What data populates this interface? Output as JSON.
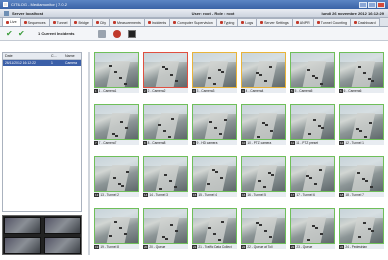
{
  "window": {
    "title": "CITILOG - Mediamonitor | 7.0.2"
  },
  "infobar": {
    "server": "Server localhost",
    "user": "User: root - Role : root",
    "datetime": "lundi 26 novembre 2012 16:12:29"
  },
  "tabs": [
    {
      "label": "Live",
      "active": true
    },
    {
      "label": "Sequences"
    },
    {
      "label": "Tunnel"
    },
    {
      "label": "Bridge"
    },
    {
      "label": "City"
    },
    {
      "label": "Measurements"
    },
    {
      "label": "Incidents"
    },
    {
      "label": "Computer Supervision"
    },
    {
      "label": "Typing"
    },
    {
      "label": "Logs"
    },
    {
      "label": "Server Settings"
    },
    {
      "label": "ANPR"
    },
    {
      "label": "Tunnel Counting"
    },
    {
      "label": "Dashboard"
    }
  ],
  "toolbar": {
    "incidents_label": "1 Current Incidents"
  },
  "incidents": {
    "columns": [
      "Date",
      "C...",
      "Name"
    ],
    "rows": [
      {
        "date": "26/11/2012 16:12:22",
        "c": "1",
        "name": "Camera"
      }
    ]
  },
  "cameras": [
    {
      "num": "1",
      "label": "1 - Camera1",
      "status": "normal"
    },
    {
      "num": "2",
      "label": "2 - Camera2",
      "status": "alarm"
    },
    {
      "num": "3",
      "label": "3 - Camera3",
      "status": "warn"
    },
    {
      "num": "4",
      "label": "4 - Camera4",
      "status": "warn"
    },
    {
      "num": "5",
      "label": "5 - Camera5",
      "status": "normal"
    },
    {
      "num": "6",
      "label": "6 - Camera6",
      "status": "normal"
    },
    {
      "num": "7",
      "label": "7 - Camera7",
      "status": "normal"
    },
    {
      "num": "8",
      "label": "8 - Camera8",
      "status": "normal"
    },
    {
      "num": "9",
      "label": "9 - HD camera",
      "status": "normal"
    },
    {
      "num": "10",
      "label": "10 - PTZ camera",
      "status": "normal"
    },
    {
      "num": "11",
      "label": "11 - PTZ preset",
      "status": "normal"
    },
    {
      "num": "12",
      "label": "12 - Tunnel 1",
      "status": "normal"
    },
    {
      "num": "13",
      "label": "13 - Tunnel 2",
      "status": "normal"
    },
    {
      "num": "14",
      "label": "14 - Tunnel 3",
      "status": "normal"
    },
    {
      "num": "15",
      "label": "15 - Tunnel 4",
      "status": "normal"
    },
    {
      "num": "16",
      "label": "16 - Tunnel 5",
      "status": "normal"
    },
    {
      "num": "17",
      "label": "17 - Tunnel 6",
      "status": "normal"
    },
    {
      "num": "18",
      "label": "18 - Tunnel 7",
      "status": "normal"
    },
    {
      "num": "19",
      "label": "19 - Tunnel 8",
      "status": "normal"
    },
    {
      "num": "20",
      "label": "20 - Queue",
      "status": "normal"
    },
    {
      "num": "21",
      "label": "21 - Traffic Data Collect",
      "status": "normal"
    },
    {
      "num": "22",
      "label": "22 - Queue at Toll",
      "status": "normal"
    },
    {
      "num": "23",
      "label": "23 - Queue",
      "status": "normal"
    },
    {
      "num": "24",
      "label": "24 - Pedestrian",
      "status": "normal"
    }
  ],
  "colors": {
    "ok": "#6fbf5a",
    "alarm": "#e05040",
    "warn": "#e8b43a",
    "selected": "#3b5fa8"
  }
}
